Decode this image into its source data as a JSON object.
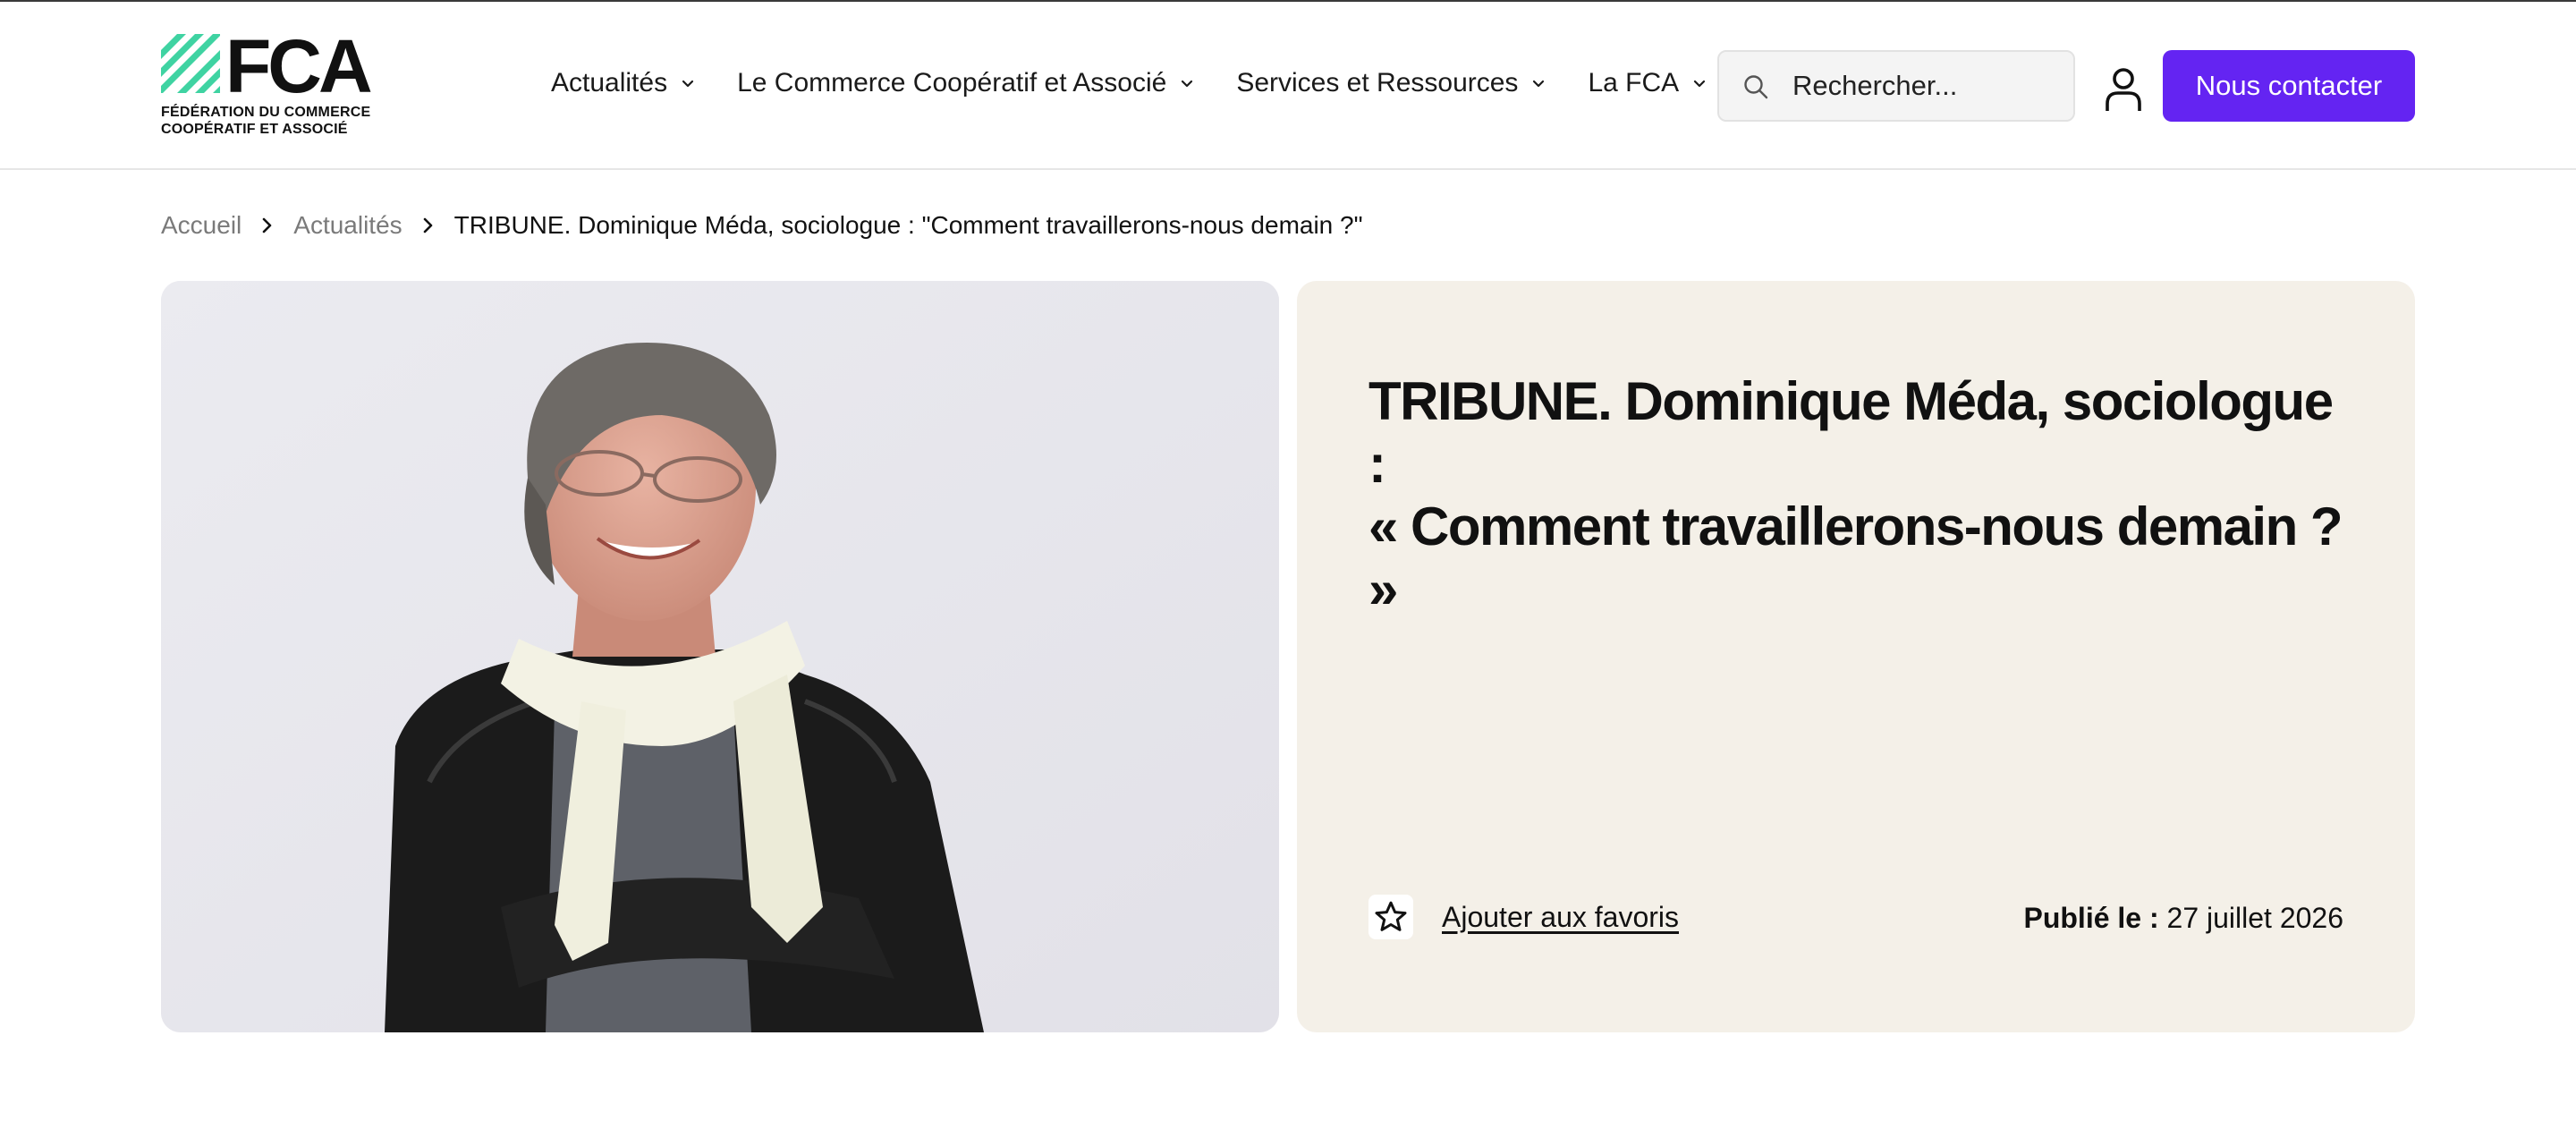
{
  "header": {
    "logo": {
      "name": "FCA",
      "subtitle": "FÉDÉRATION DU COMMERCE\nCOOPÉRATIF ET ASSOCIÉ",
      "brand_color": "#3fd3a2"
    },
    "nav": [
      {
        "label": "Actualités",
        "icon": "chevron-down-icon"
      },
      {
        "label": "Le Commerce Coopératif et Associé",
        "icon": "chevron-down-icon"
      },
      {
        "label": "Services et Ressources",
        "icon": "chevron-down-icon"
      },
      {
        "label": "La FCA",
        "icon": "chevron-down-icon"
      }
    ],
    "search": {
      "placeholder": "Rechercher...",
      "icon": "search-icon"
    },
    "user_icon": "user-icon",
    "contact_button": {
      "label": "Nous contacter",
      "color": "#6424f2"
    }
  },
  "breadcrumb": {
    "items": [
      "Accueil",
      "Actualités"
    ],
    "current": "TRIBUNE. Dominique Méda, sociologue : \"Comment travaillerons-nous demain ?\""
  },
  "article": {
    "title_line1": "TRIBUNE. Dominique Méda, sociologue :",
    "title_line2": "« Comment travaillerons-nous demain ? »",
    "favorite_label": "Ajouter aux favoris",
    "favorite_icon": "star-icon",
    "published_label": "Publié le :",
    "published_date": "27 juillet 2026",
    "card_color": "#f4f0e8"
  }
}
